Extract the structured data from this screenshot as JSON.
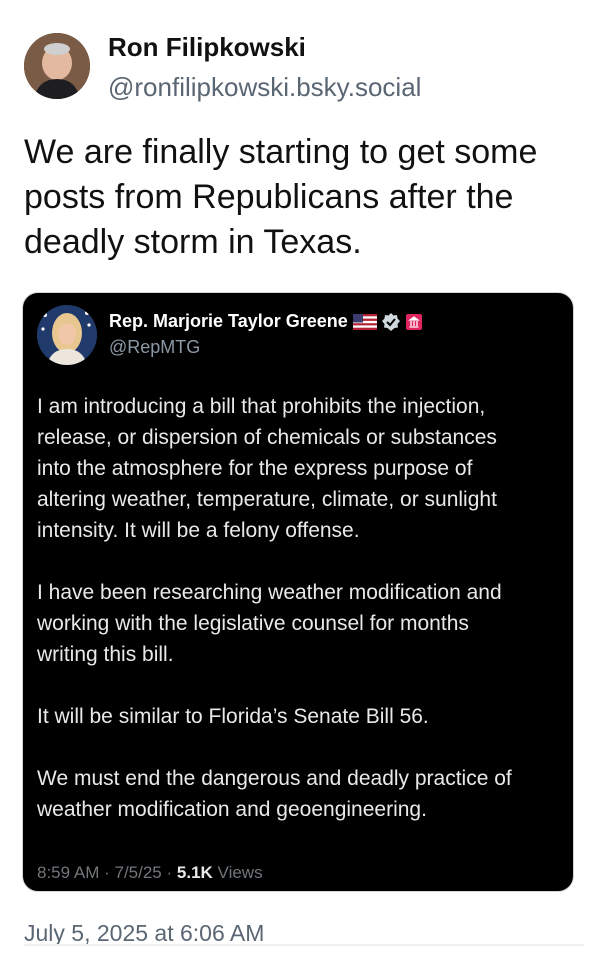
{
  "post": {
    "author_name": "Ron Filipkowski",
    "author_handle": "@ronfilipkowski.bsky.social",
    "text": "We are finally starting to get some\nposts from Republicans after the\ndeadly storm in Texas.",
    "timestamp": "July 5, 2025 at 6:06 AM"
  },
  "quoted_post": {
    "author_name": "Rep. Marjorie Taylor Greene",
    "author_handle": "@RepMTG",
    "paragraphs": [
      "I am introducing a bill that prohibits the injection,\nrelease, or dispersion of chemicals or substances\ninto the atmosphere for the express purpose of\naltering weather, temperature, climate, or sunlight\nintensity. It will be a felony offense.",
      "I have been researching weather modification and\nworking with the legislative counsel for months\nwriting this bill.",
      "It will be similar to Florida’s Senate Bill 56.",
      "We must end the dangerous and deadly practice of\nweather modification and geoengineering."
    ],
    "time": "8:59 AM",
    "date": "7/5/25",
    "views_count": "5.1K",
    "views_label": "Views",
    "badges": [
      "us-flag-icon",
      "verified-badge-icon",
      "government-badge-icon"
    ]
  },
  "colors": {
    "quote_background": "#000000",
    "muted_text": "#5b6673",
    "quote_text": "#e7e9ea",
    "government_badge": "#e0245e"
  }
}
